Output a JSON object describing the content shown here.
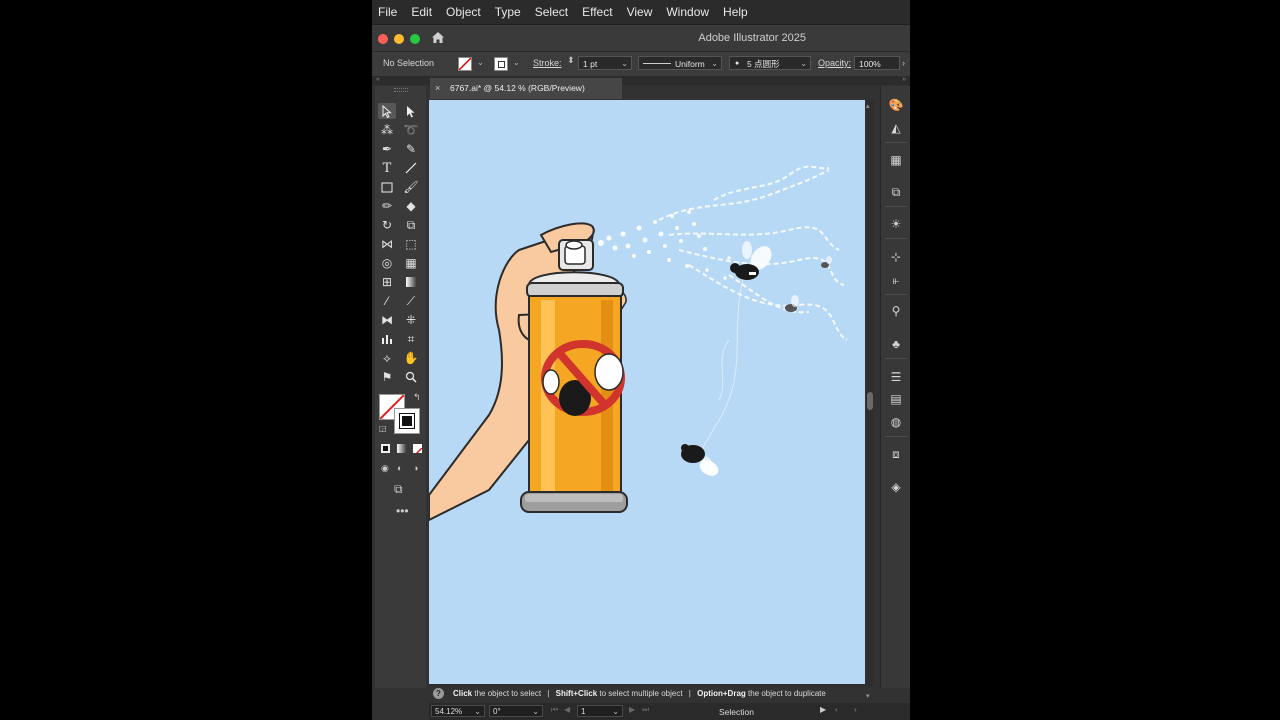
{
  "menubar": {
    "items": [
      "File",
      "Edit",
      "Object",
      "Type",
      "Select",
      "Effect",
      "View",
      "Window",
      "Help"
    ]
  },
  "titlebar": {
    "title": "Adobe Illustrator 2025"
  },
  "control_bar": {
    "selection_status": "No Selection",
    "stroke_label": "Stroke:",
    "stroke_weight": "1 pt",
    "stroke_profile": "Uniform",
    "brush": "5 点圆形",
    "opacity_label": "Opacity:",
    "opacity_value": "100%"
  },
  "document_tab": {
    "title": "6767.ai* @ 54.12 % (RGB/Preview)"
  },
  "hint_bar": {
    "part1_bold": "Click",
    "part1": " the object to select",
    "sep1": "|",
    "part2_bold": "Shift+Click",
    "part2": " to select multiple object",
    "sep2": "|",
    "part3_bold": "Option+Drag",
    "part3": " the object to duplicate"
  },
  "status_bar": {
    "zoom": "54.12%",
    "rotation": "0°",
    "artboard_number": "1",
    "current_tool": "Selection"
  },
  "colors": {
    "artboard": "#b8d9f5",
    "can_orange": "#f5a623",
    "prohibit_red": "#d0342c",
    "skin": "#f9c9a0"
  }
}
